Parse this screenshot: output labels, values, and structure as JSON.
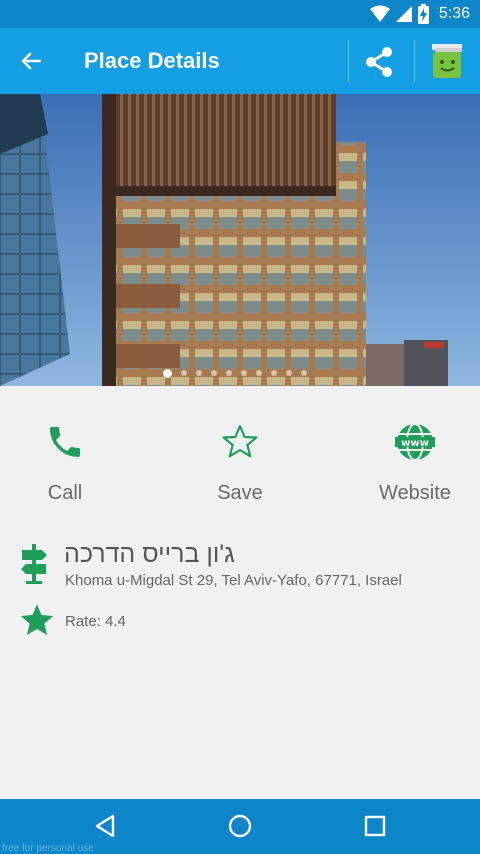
{
  "status_bar": {
    "time": "5:36",
    "battery_glyph": "battery-charging-icon"
  },
  "app_bar": {
    "title": "Place Details",
    "back_icon": "arrow-left-icon",
    "share_icon": "share-icon",
    "mascot_icon": "bag-mascot-icon"
  },
  "gallery": {
    "image_count": 10,
    "selected_index": 0
  },
  "actions": [
    {
      "label": "Call",
      "icon": "phone-icon"
    },
    {
      "label": "Save",
      "icon": "star-outline-icon"
    },
    {
      "label": "Website",
      "icon": "globe-www-icon"
    }
  ],
  "place": {
    "name": "ג'ון ברייס הדרכה",
    "address": "Khoma u-Migdal St 29, Tel Aviv-Yafo, 67771, Israel",
    "rate_text": "Rate: 4.4"
  },
  "nav": {
    "back": "back-triangle-icon",
    "home": "home-circle-icon",
    "recents": "recents-square-icon"
  },
  "watermark": "free for personal use",
  "colors": {
    "status_bar": "#0c86c8",
    "app_bar": "#149ee4",
    "accent_green": "#1e9e5a",
    "background": "#f1f1f1"
  }
}
